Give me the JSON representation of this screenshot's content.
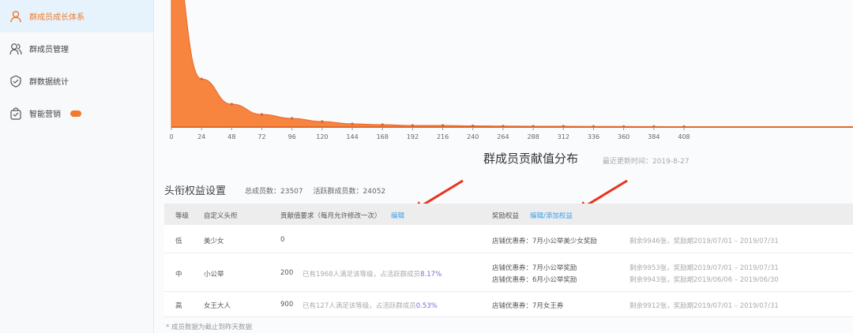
{
  "sidebar": {
    "items": [
      {
        "label": "群成员成长体系",
        "icon": "user-icon",
        "active": true
      },
      {
        "label": "群成员管理",
        "icon": "users-icon"
      },
      {
        "label": "群数据统计",
        "icon": "shield-icon"
      },
      {
        "label": "智能营销",
        "icon": "bag-icon",
        "badge": true
      }
    ]
  },
  "chart_data": {
    "type": "area",
    "title": "群成员贡献值分布",
    "x": [
      0,
      24,
      48,
      72,
      96,
      120,
      144,
      168,
      192,
      216,
      240,
      264,
      288,
      312,
      336,
      360,
      384,
      408
    ],
    "values": [
      260,
      61,
      29,
      16,
      11,
      7,
      4,
      3,
      2,
      2,
      1.5,
      1.2,
      1,
      1,
      0.8,
      0.7,
      0.6,
      0.5
    ],
    "tick_labels": [
      "0",
      "24",
      "48",
      "72",
      "96",
      "120",
      "144",
      "168",
      "192",
      "216",
      "240",
      "264",
      "288",
      "312",
      "336",
      "360",
      "384",
      "408"
    ],
    "xlabel": "",
    "ylabel": "",
    "xlim": [
      0,
      420
    ],
    "ylim": [
      0,
      161
    ],
    "color": "#f7843f"
  },
  "chart_meta": {
    "update_time": "最近更新时间：2019-8-27"
  },
  "section": {
    "title": "头衔权益设置",
    "total_members": "总成员数：23507",
    "active_members": "活跃群成员数：24052"
  },
  "table": {
    "headers": {
      "level": "等级",
      "title": "自定义头衔",
      "requirement": "贡献值要求（每月允许修改一次）",
      "edit": "编辑",
      "reward": "奖励权益",
      "edit_add": "编辑/添加权益"
    },
    "rows": [
      {
        "level": "低",
        "title": "美少女",
        "value": "0",
        "desc": "",
        "pct": "",
        "rewards": [
          {
            "name": "店铺优惠券：7月小公举美少女奖励",
            "info": "剩余9946张，奖励期2019/07/01 – 2019/07/31"
          }
        ]
      },
      {
        "level": "中",
        "title": "小公举",
        "value": "200",
        "desc": "已有1968人满足该等级，占活跃群成员",
        "pct": "8.17%",
        "rewards": [
          {
            "name": "店铺优惠券：7月小公举奖励",
            "info": "剩余9953张，奖励期2019/07/01 – 2019/07/31"
          },
          {
            "name": "店铺优惠券：6月小公举奖励",
            "info": "剩余9943张，奖励期2019/06/06 – 2019/06/30"
          }
        ]
      },
      {
        "level": "高",
        "title": "女王大人",
        "value": "900",
        "desc": "已有127人满足该等级，占活跃群成员",
        "pct": "0.53%",
        "rewards": [
          {
            "name": "店铺优惠券：7月女王券",
            "info": "剩余9912张，奖励期2019/07/01 – 2019/07/31"
          }
        ]
      }
    ],
    "note": "* 成员数据为截止到昨天数据"
  }
}
